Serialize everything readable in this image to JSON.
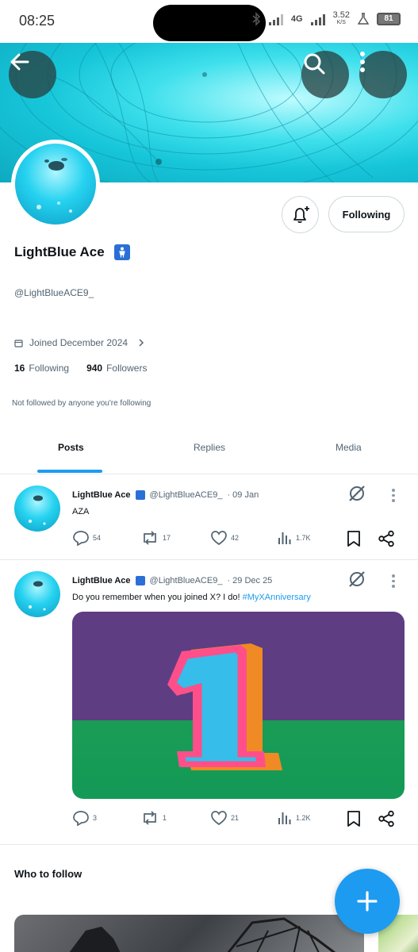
{
  "status_bar": {
    "time": "08:25",
    "network": "4G",
    "speed_value": "3.52",
    "speed_unit": "K/S",
    "battery": "81"
  },
  "profile": {
    "display_name": "LightBlue Ace",
    "handle": "@LightBlueACE9_",
    "joined": "Joined December 2024",
    "following_count": "16",
    "following_label": "Following",
    "followers_count": "940",
    "followers_label": "Followers",
    "not_followed_text": "Not followed by anyone you're following",
    "follow_state_button": "Following"
  },
  "tabs": [
    {
      "label": "Posts",
      "active": true
    },
    {
      "label": "Replies",
      "active": false
    },
    {
      "label": "Media",
      "active": false
    }
  ],
  "posts": [
    {
      "name": "LightBlue Ace",
      "handle": "@LightBlueACE9_",
      "time": "· 09 Jan",
      "text": "AZA",
      "replies": "54",
      "reposts": "17",
      "likes": "42",
      "views": "1.7K"
    },
    {
      "name": "LightBlue Ace",
      "handle": "@LightBlueACE9_",
      "time": "· 29 Dec 25",
      "text": "Do you remember when you joined X? I do! ",
      "hashtag": "#MyXAnniversary",
      "replies": "3",
      "reposts": "1",
      "likes": "21",
      "views": "1.2K"
    }
  ],
  "who_to_follow": {
    "title": "Who to follow"
  },
  "colors": {
    "accent": "#1d9bf0",
    "banner": "#17c6d9",
    "text": "#0f1419",
    "muted": "#536471"
  }
}
